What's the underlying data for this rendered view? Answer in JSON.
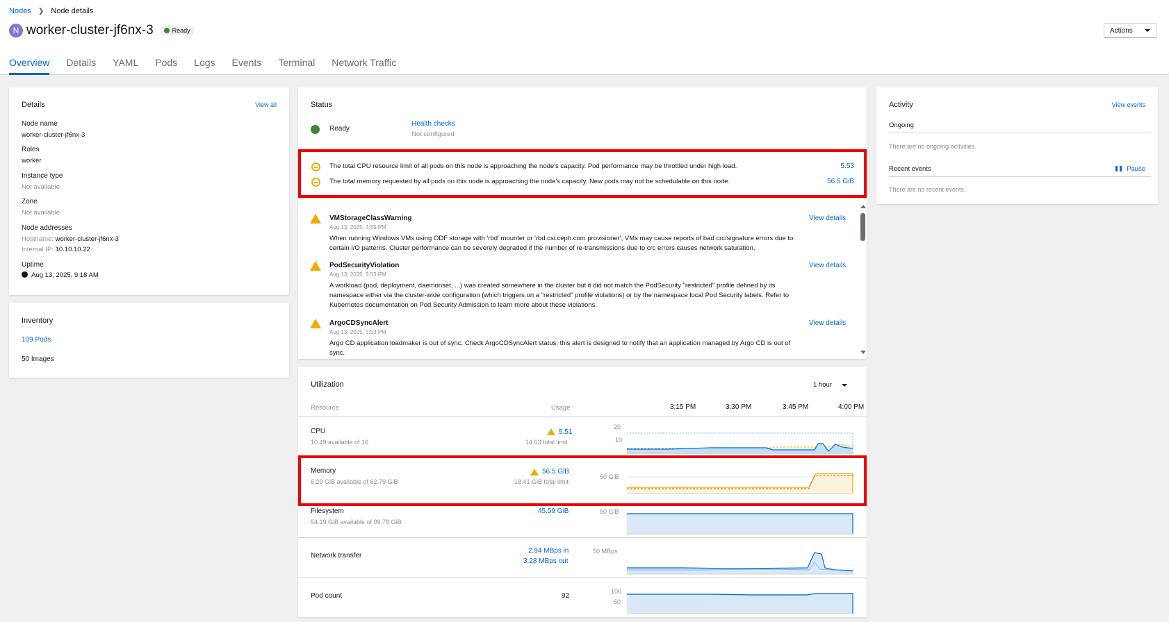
{
  "breadcrumb": {
    "parent": "Nodes",
    "current": "Node details"
  },
  "header": {
    "badge": "N",
    "title": "worker-cluster-jf6nx-3",
    "status": "Ready",
    "actions": "Actions"
  },
  "tabs": [
    "Overview",
    "Details",
    "YAML",
    "Pods",
    "Logs",
    "Events",
    "Terminal",
    "Network Traffic"
  ],
  "details": {
    "title": "Details",
    "view_all": "View all",
    "node_name_label": "Node name",
    "node_name": "worker-cluster-jf6nx-3",
    "roles_label": "Roles",
    "roles": "worker",
    "instance_type_label": "Instance type",
    "instance_type": "Not available",
    "zone_label": "Zone",
    "zone": "Not available",
    "addresses_label": "Node addresses",
    "hostname_key": "Hostname:",
    "hostname": "worker-cluster-jf6nx-3",
    "internal_ip_key": "Internal IP:",
    "internal_ip": "10.10.10.22",
    "uptime_label": "Uptime",
    "uptime": "Aug 13, 2025, 9:18 AM"
  },
  "inventory": {
    "title": "Inventory",
    "pods": "109 Pods",
    "images": "50 Images"
  },
  "status": {
    "title": "Status",
    "ready": "Ready",
    "health_checks": "Health checks",
    "health_status": "Not configured",
    "alerts": [
      {
        "text": "The total CPU resource limit of all pods on this node is approaching the node's capacity. Pod performance may be throttled under high load.",
        "value": "5.53"
      },
      {
        "text": "The total memory requested by all pods on this node is approaching the node's capacity. New pods may not be schedulable on this node.",
        "value": "56.5 GiB"
      }
    ],
    "events": [
      {
        "name": "VMStorageClassWarning",
        "time": "Aug 13, 2025, 3:55 PM",
        "link": "View details",
        "desc": "When running Windows VMs using ODF storage with 'rbd' mounter or 'rbd.csi.ceph.com provisioner', VMs may cause reports of bad crc/signature errors due to certain I/O patterns. Cluster performance can be severely degraded if the number of re-transmissions due to crc errors causes network saturation."
      },
      {
        "name": "PodSecurityViolation",
        "time": "Aug 13, 2025, 3:53 PM",
        "link": "View details",
        "desc": "A workload (pod, deployment, daemonset, ...) was created somewhere in the cluster but it did not match the PodSecurity \"restricted\" profile defined by its namespace either via the cluster-wide configuration (which triggers on a \"restricted\" profile violations) or by the namespace local Pod Security labels. Refer to Kubernetes documentation on Pod Security Admission to learn more about these violations."
      },
      {
        "name": "ArgoCDSyncAlert",
        "time": "Aug 13, 2025, 3:53 PM",
        "link": "View details",
        "desc": "Argo CD application loadmaker is out of sync. Check ArgoCDSyncAlert status, this alert is designed to notify that an application managed by Argo CD is out of sync."
      }
    ]
  },
  "utilization": {
    "title": "Utilization",
    "range": "1 hour",
    "col_resource": "Resource",
    "col_usage": "Usage",
    "times": [
      "3:15 PM",
      "3:30 PM",
      "3:45 PM",
      "4:00 PM"
    ],
    "rows": [
      {
        "name": "CPU",
        "sub": "10.49 available of 16",
        "value": "5.51",
        "limit": "14.63 total limit",
        "ticks": [
          "20",
          "10"
        ]
      },
      {
        "name": "Memory",
        "sub": "6.29 GiB available of 62.79 GiB",
        "value": "56.5 GiB",
        "limit": "18.41 GiB total limit",
        "ticks": [
          "50 GiB"
        ]
      },
      {
        "name": "Filesystem",
        "sub": "54.19 GiB available of 99.78 GiB",
        "value": "45.59 GiB",
        "ticks": [
          "50 GiB"
        ]
      },
      {
        "name": "Network transfer",
        "value_in": "2.94 MBps in",
        "value_out": "3.28 MBps out",
        "ticks": [
          "50 MBps"
        ]
      },
      {
        "name": "Pod count",
        "value": "92",
        "ticks": [
          "100",
          "50"
        ]
      }
    ]
  },
  "activity": {
    "title": "Activity",
    "view_events": "View events",
    "ongoing": "Ongoing",
    "ongoing_empty": "There are no ongoing activities.",
    "recent": "Recent events",
    "pause": "Pause",
    "recent_empty": "There are no recent events."
  },
  "colors": {
    "accent": "#0066cc",
    "warning": "#f0ab00",
    "success": "#3e8635",
    "highlight": "#ee0000"
  }
}
